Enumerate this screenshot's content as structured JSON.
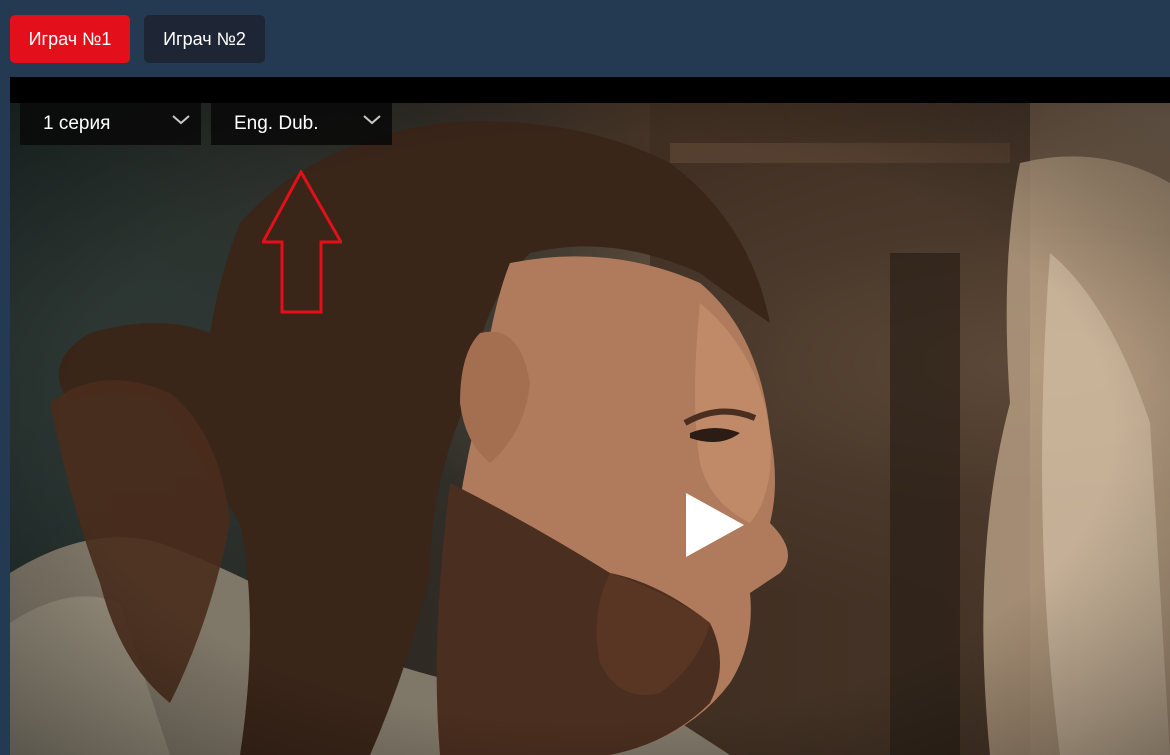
{
  "tabs": [
    {
      "label": "Играч №1",
      "active": true
    },
    {
      "label": "Играч №2",
      "active": false
    }
  ],
  "player": {
    "episode_select": {
      "value": "1 серия"
    },
    "dub_select": {
      "value": "Eng. Dub."
    },
    "play_icon": "play-icon"
  },
  "colors": {
    "page_bg": "#243a52",
    "active_tab": "#e3101b",
    "inactive_tab": "#1e2535",
    "annotation": "#e3101b"
  }
}
